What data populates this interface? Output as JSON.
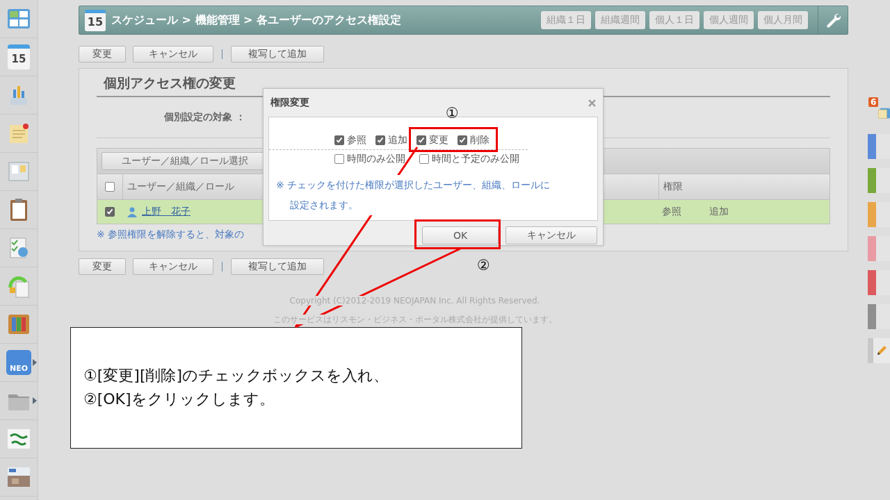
{
  "sidebar": {
    "items": [
      {
        "kind": "portal",
        "has_submenu": false
      },
      {
        "kind": "calendar",
        "label": "15",
        "has_submenu": false
      },
      {
        "kind": "chart",
        "has_submenu": false
      },
      {
        "kind": "memo",
        "has_submenu": false
      },
      {
        "kind": "board",
        "has_submenu": false
      },
      {
        "kind": "clipboard",
        "has_submenu": false
      },
      {
        "kind": "survey",
        "has_submenu": false
      },
      {
        "kind": "refresh",
        "has_submenu": false
      },
      {
        "kind": "binders",
        "has_submenu": false
      },
      {
        "kind": "neo",
        "label": "NEO",
        "has_submenu": true
      },
      {
        "kind": "folder",
        "has_submenu": true
      },
      {
        "kind": "logo",
        "has_submenu": false
      },
      {
        "kind": "banner",
        "has_submenu": false
      }
    ]
  },
  "header": {
    "icon_day": "15",
    "breadcrumb": "スケジュール > 機能管理 > 各ユーザーのアクセス権設定",
    "view_buttons": [
      "組織１日",
      "組織週間",
      "個人１日",
      "個人週間",
      "個人月間"
    ]
  },
  "toolbar_top": {
    "buttons": [
      "変更",
      "キャンセル"
    ],
    "copy_button": "複写して追加"
  },
  "panel": {
    "title": "個別アクセス権の変更",
    "target_label": "個別設定の対象 ：",
    "select_button": "ユーザー／組織／ロール選択",
    "table": {
      "header_checked": false,
      "columns": [
        "ユーザー／組織／ロール",
        "権限"
      ],
      "rows": [
        {
          "checked": true,
          "selected": true,
          "name": "上野　花子",
          "permissions": [
            "参照",
            "追加"
          ]
        }
      ]
    },
    "note": "※ 参照権限を解除すると、対象の"
  },
  "toolbar_bottom": {
    "buttons": [
      "変更",
      "キャンセル"
    ],
    "copy_button": "複写して追加"
  },
  "footer": {
    "copyright": "Copyright (C)2012-2019 NEOJAPAN Inc. All Rights Reserved.",
    "provider": "このサービスはリスモン・ビジネス・ポータル株式会社が提供しています。"
  },
  "dialog": {
    "title": "権限変更",
    "permissions": [
      {
        "label": "参照",
        "checked": true
      },
      {
        "label": "追加",
        "checked": true
      },
      {
        "label": "変更",
        "checked": true
      },
      {
        "label": "削除",
        "checked": true
      }
    ],
    "publish_options": [
      {
        "label": "時間のみ公開",
        "checked": false
      },
      {
        "label": "時間と予定のみ公開",
        "checked": false
      }
    ],
    "note": "※ チェックを付けた権限が選択したユーザー、組織、ロールに設定されます。",
    "buttons": [
      "OK",
      "キャンセル"
    ]
  },
  "right_rail": {
    "badge": "6",
    "calendars": [
      {
        "color": "#5b8ad8"
      },
      {
        "color": "#79a83c"
      },
      {
        "color": "#e9a54a"
      },
      {
        "color": "#e99aa2"
      },
      {
        "color": "#dc5a5e"
      },
      {
        "color": "#8f8f8f"
      }
    ]
  },
  "annotations": {
    "marker_1": "①",
    "marker_2": "②",
    "callout_lines": [
      "①[変更][削除]のチェックボックスを入れ、",
      "②[OK]をクリックします。"
    ]
  }
}
